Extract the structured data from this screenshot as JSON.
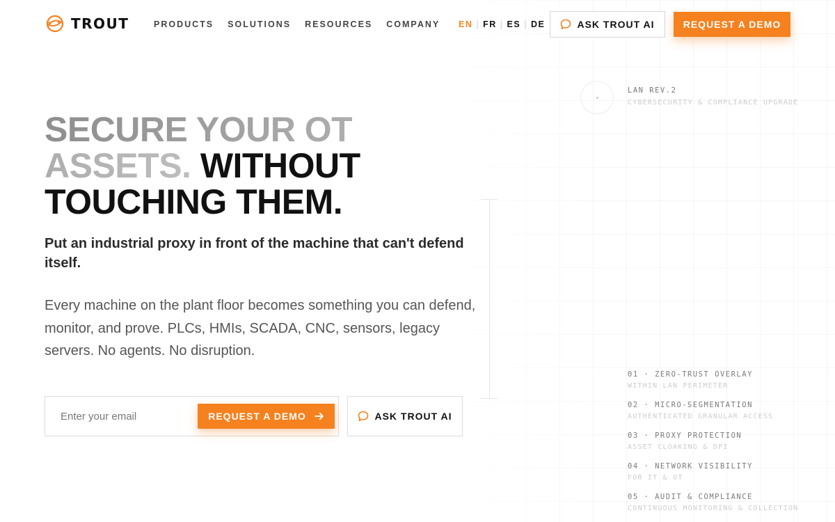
{
  "brand": {
    "name": "TROUT",
    "accent": "#f5811f"
  },
  "nav": {
    "items": [
      "PRODUCTS",
      "SOLUTIONS",
      "RESOURCES",
      "COMPANY"
    ]
  },
  "languages": {
    "items": [
      "EN",
      "FR",
      "ES",
      "DE"
    ],
    "active": "EN"
  },
  "header": {
    "ask_label": "ASK TROUT AI",
    "demo_label": "REQUEST A DEMO"
  },
  "hero": {
    "headline_muted": "SECURE YOUR OT ASSETS.",
    "headline_strong": "WITHOUT TOUCHING THEM.",
    "subhead": "Put an industrial proxy in front of the machine that can't defend itself.",
    "body": "Every machine on the plant floor becomes something you can defend, monitor, and prove. PLCs, HMIs, SCADA, CNC, sensors, legacy servers. No agents. No disruption.",
    "email_placeholder": "Enter your email",
    "email_value": "",
    "demo_label": "REQUEST A DEMO",
    "ask_label": "ASK TROUT AI"
  },
  "diagram": {
    "lan_title": "LAN REV.2",
    "lan_subtitle": "CYBERSECURITY & COMPLIANCE UPGRADE",
    "features": [
      {
        "title": "01 · ZERO-TRUST OVERLAY",
        "subtitle": "WITHIN LAN PERIMETER"
      },
      {
        "title": "02 · MICRO-SEGMENTATION",
        "subtitle": "AUTHENTICATED GRANULAR ACCESS"
      },
      {
        "title": "03 · PROXY PROTECTION",
        "subtitle": "ASSET CLOAKING & DPI"
      },
      {
        "title": "04 · NETWORK VISIBILITY",
        "subtitle": "FOR IT & OT"
      },
      {
        "title": "05 · AUDIT & COMPLIANCE",
        "subtitle": "CONTINUOUS MONITORING & COLLECTION"
      }
    ]
  },
  "icons": {
    "logo": "trout-fish-icon",
    "chat": "chat-bubble-icon",
    "arrow": "arrow-right-icon"
  }
}
